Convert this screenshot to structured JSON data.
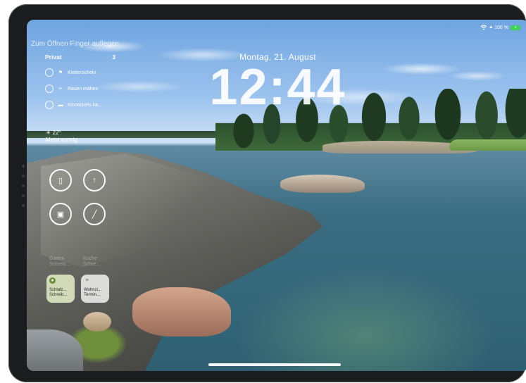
{
  "status_bar": {
    "battery_text": "100 %",
    "wifi_icon": "wifi-icon",
    "lock_icon": "lock-icon",
    "battery_icon": "battery-charging-icon"
  },
  "lock_screen": {
    "unlock_hint": "Zum Öffnen Finger auflegen",
    "date": "Montag, 21. August",
    "time": "12:44"
  },
  "reminders": {
    "title": "Privat",
    "count": "3",
    "items": [
      {
        "icon": "flag-icon",
        "glyph": "⚑",
        "label": "Kletterschein"
      },
      {
        "icon": "lawnmower-icon",
        "glyph": "✂",
        "label": "Rasen mähen"
      },
      {
        "icon": "ticket-icon",
        "glyph": "▬",
        "label": "Kinotickets ka..."
      }
    ]
  },
  "weather": {
    "icon": "sun-icon",
    "temperature": "22°",
    "condition": "Meist sonnig"
  },
  "gauges": [
    {
      "icon": "phone-icon",
      "glyph": "▯"
    },
    {
      "icon": "timer-icon",
      "glyph": "↑"
    },
    {
      "icon": "calendar-icon",
      "glyph": "▣"
    },
    {
      "icon": "compass-icon",
      "glyph": "╱"
    }
  ],
  "faded_labels": [
    {
      "line1": "Garten",
      "line2": "Schreib..."
    },
    {
      "line1": "Küche",
      "line2": "Schre..."
    }
  ],
  "home_widgets": [
    {
      "icon": "sleep-icon",
      "glyph": "●",
      "line1": "Schlafz...",
      "line2": "Schreib..."
    },
    {
      "icon": "list-icon",
      "glyph": "≡",
      "line1": "Wohnzi...",
      "line2": "Termin..."
    }
  ]
}
